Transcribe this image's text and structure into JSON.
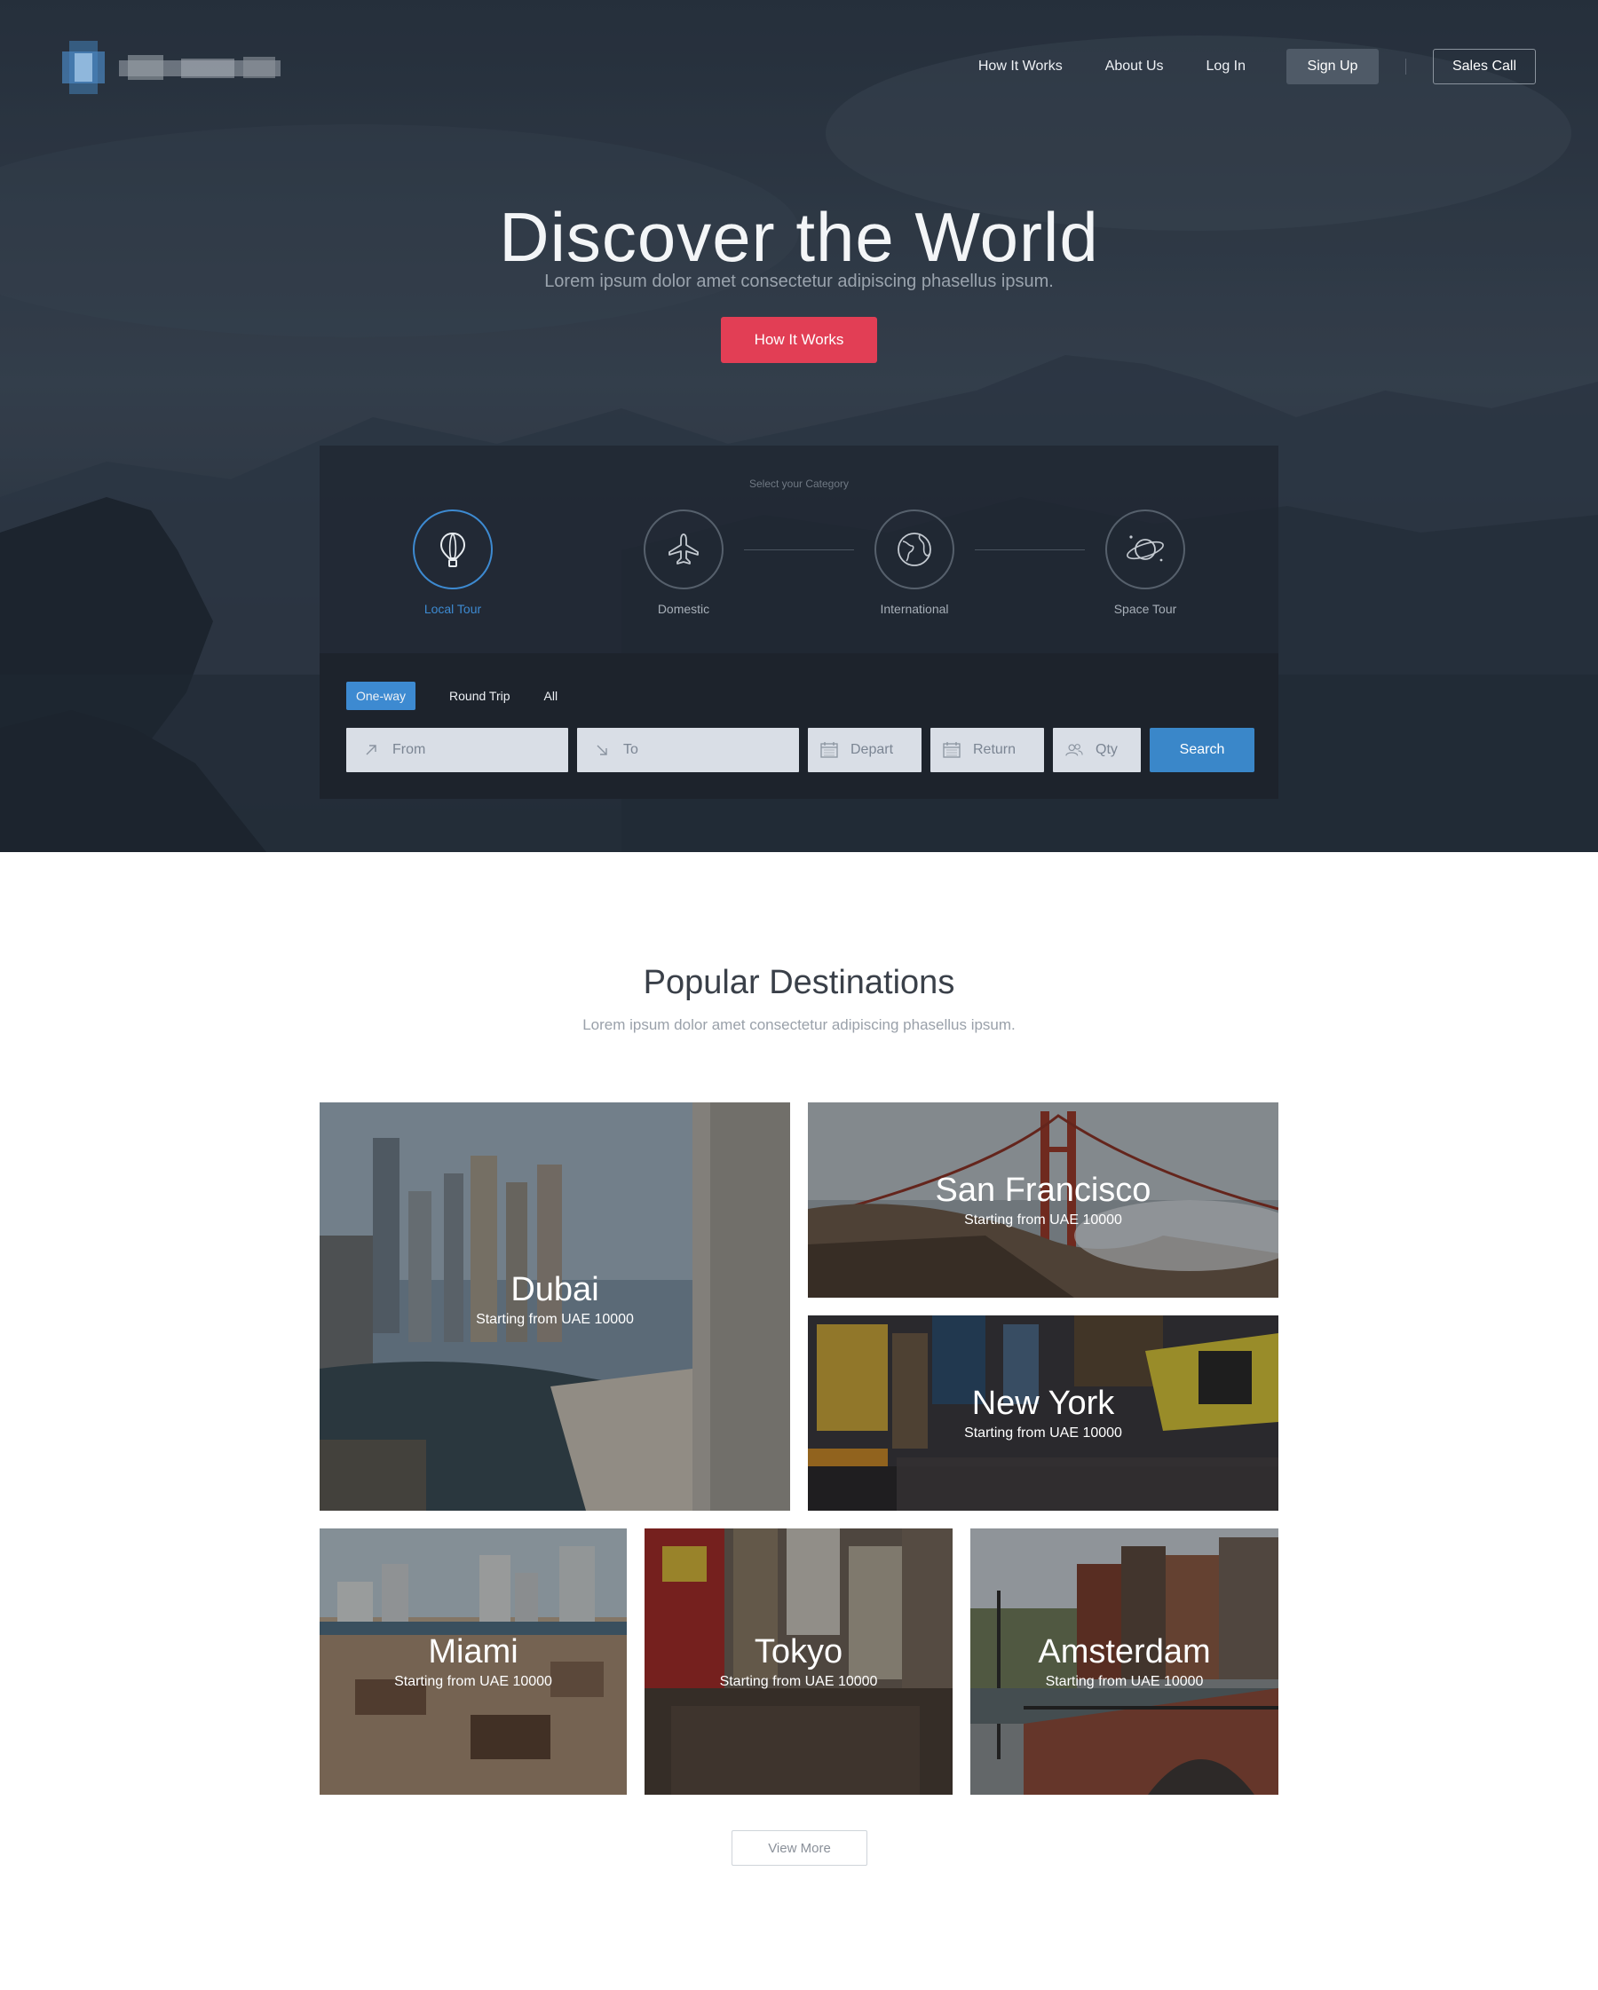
{
  "header": {
    "nav": {
      "how_it_works": "How It Works",
      "about_us": "About Us",
      "log_in": "Log In",
      "sign_up": "Sign Up",
      "sales_call": "Sales Call"
    }
  },
  "hero": {
    "title": "Discover the World",
    "subtitle": "Lorem ipsum dolor amet consectetur adipiscing phasellus ipsum.",
    "cta": "How It Works"
  },
  "search": {
    "category_heading": "Select your Category",
    "categories": [
      {
        "label": "Local Tour",
        "icon": "balloon-icon",
        "active": true
      },
      {
        "label": "Domestic",
        "icon": "airplane-icon",
        "active": false
      },
      {
        "label": "International",
        "icon": "globe-icon",
        "active": false
      },
      {
        "label": "Space Tour",
        "icon": "planet-icon",
        "active": false
      }
    ],
    "trip_tabs": [
      "One-way",
      "Round Trip",
      "All"
    ],
    "active_tab": "One-way",
    "fields": {
      "from": "From",
      "to": "To",
      "depart": "Depart",
      "return": "Return",
      "qty": "Qty"
    },
    "search_button": "Search"
  },
  "destinations": {
    "title": "Popular Destinations",
    "subtitle": "Lorem ipsum dolor amet consectetur adipiscing phasellus ipsum.",
    "cards": [
      {
        "city": "Dubai",
        "price": "Starting from UAE 10000"
      },
      {
        "city": "San Francisco",
        "price": "Starting from UAE 10000"
      },
      {
        "city": "New York",
        "price": "Starting from UAE 10000"
      },
      {
        "city": "Miami",
        "price": "Starting from UAE 10000"
      },
      {
        "city": "Tokyo",
        "price": "Starting from UAE 10000"
      },
      {
        "city": "Amsterdam",
        "price": "Starting from UAE 10000"
      }
    ],
    "view_more": "View More"
  },
  "colors": {
    "accent_blue": "#3d8ad1",
    "cta_red": "#e23e55",
    "hero_dark": "#283140"
  }
}
